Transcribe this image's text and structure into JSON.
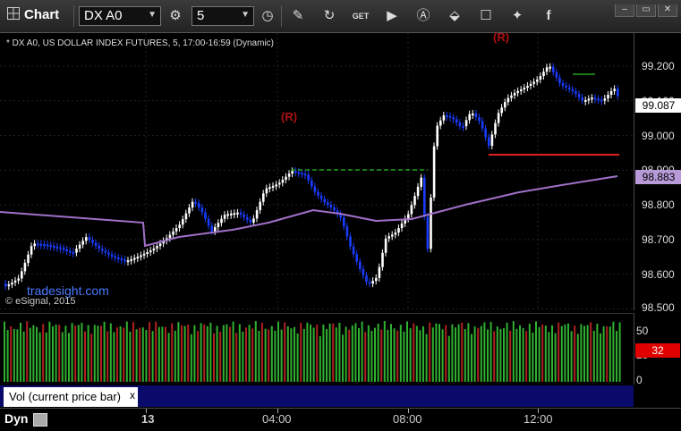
{
  "toolbar": {
    "app_title": "Chart",
    "symbol": "DX A0",
    "interval": "5",
    "icons": [
      "link-icon",
      "clock-icon",
      "pencil-icon",
      "refresh-icon",
      "get-icon",
      "play-icon",
      "text-tool-icon",
      "tag-icon",
      "comment-icon",
      "twitter-icon",
      "facebook-icon"
    ],
    "window_buttons": [
      "minimize-icon",
      "restore-icon",
      "close-icon"
    ]
  },
  "chart": {
    "header": "* DX A0, US DOLLAR INDEX FUTURES, 5, 17:00-16:59 (Dynamic)",
    "watermark_site": "tradesight.com",
    "watermark_copyright": "© eSignal, 2015",
    "r_labels": [
      "(R)",
      "(R)"
    ],
    "price_ticks": [
      "99.200",
      "99.100",
      "99.000",
      "98.900",
      "98.800",
      "98.700",
      "98.600",
      "98.500"
    ],
    "last_price": "99.087",
    "ma_price": "98.883",
    "colors": {
      "up": "#ffffff",
      "down": "#1a3cff",
      "ma": "#a070c8",
      "seq": "#40b040",
      "res": "#e02020",
      "support": "#20a020"
    }
  },
  "volume": {
    "label": "Vol (current price bar)",
    "close_glyph": "x",
    "ticks": [
      "50",
      "25",
      "0"
    ],
    "last_value": "32",
    "colors": {
      "up": "#30b030",
      "down": "#b02020"
    }
  },
  "time_axis": {
    "mode": "Dyn",
    "labels": [
      "13",
      "04:00",
      "08:00",
      "12:00"
    ]
  }
}
